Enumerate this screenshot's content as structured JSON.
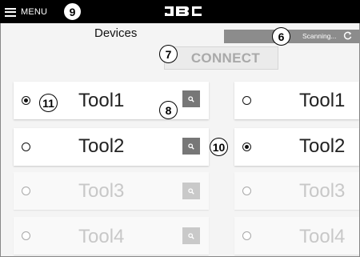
{
  "topbar": {
    "menu_label": "MENU",
    "logo_text": "JBC"
  },
  "header": {
    "title": "Devices",
    "scan_status": "Scanning..."
  },
  "connect_label": "CONNECT",
  "left_tools": [
    {
      "label": "Tool1",
      "selected": true,
      "enabled": true
    },
    {
      "label": "Tool2",
      "selected": false,
      "enabled": true
    },
    {
      "label": "Tool3",
      "selected": false,
      "enabled": false
    },
    {
      "label": "Tool4",
      "selected": false,
      "enabled": false
    }
  ],
  "right_tools": [
    {
      "label": "Tool1",
      "selected": false,
      "enabled": true
    },
    {
      "label": "Tool2",
      "selected": true,
      "enabled": true
    },
    {
      "label": "Tool3",
      "selected": false,
      "enabled": false
    },
    {
      "label": "Tool4",
      "selected": false,
      "enabled": false
    }
  ],
  "callouts": {
    "menu": "9",
    "scanning": "6",
    "connect": "7",
    "search": "8",
    "left_radio": "11",
    "right_radio": "10"
  },
  "icons": {
    "menu": "hamburger-icon",
    "refresh": "refresh-icon",
    "search": "search-icon"
  },
  "colors": {
    "topbar": "#000000",
    "background": "#f4f4f4",
    "scan_bar": "#8c8c8c",
    "search_enabled": "#777777",
    "search_disabled": "#c9c9c9",
    "text_disabled": "#c8c8c8"
  }
}
